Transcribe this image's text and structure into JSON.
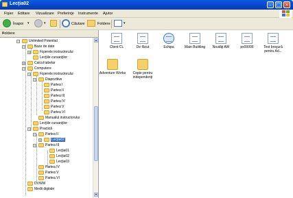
{
  "window": {
    "title": "Lecţia02"
  },
  "menu": [
    "Fişier",
    "Editare",
    "Vizualizare",
    "Preferinţe",
    "Instrumente",
    "Ajutor"
  ],
  "toolbar": {
    "back_label": "Înapoi",
    "search_label": "Căutare",
    "folders_label": "Foldere"
  },
  "panel": {
    "title": "Foldere",
    "close_glyph": "×"
  },
  "tree": [
    {
      "label": "Unlimited Potential",
      "expander": "−"
    },
    {
      "label": "Baze de date",
      "expander": "−"
    },
    {
      "label": "Fişierele instructorului",
      "expander": "+"
    },
    {
      "label": "Lecţiile cursanţilor",
      "expander": ""
    },
    {
      "label": "Calcul tabelar",
      "expander": "+"
    },
    {
      "label": "Computere",
      "expander": "−"
    },
    {
      "label": "Fişierele instructorului",
      "expander": "−"
    },
    {
      "label": "Diapozitive",
      "expander": "−"
    },
    {
      "label": "Partea I",
      "expander": ""
    },
    {
      "label": "Partea II",
      "expander": ""
    },
    {
      "label": "Partea III",
      "expander": ""
    },
    {
      "label": "Partea IV",
      "expander": ""
    },
    {
      "label": "Partea V",
      "expander": ""
    },
    {
      "label": "Partea VI",
      "expander": ""
    },
    {
      "label": "Manualul instructorului",
      "expander": ""
    },
    {
      "label": "Lecţiile cursanţilor",
      "expander": ""
    },
    {
      "label": "Practică",
      "expander": "−"
    },
    {
      "label": "Partea II",
      "expander": "−"
    },
    {
      "label": "Lecţia02",
      "expander": "+"
    },
    {
      "label": "Partea III",
      "expander": "−"
    },
    {
      "label": "Lecţia01",
      "expander": ""
    },
    {
      "label": "Lecţia02",
      "expander": ""
    },
    {
      "label": "Lecţia03",
      "expander": ""
    },
    {
      "label": "Partea IV",
      "expander": ""
    },
    {
      "label": "Partea V",
      "expander": ""
    },
    {
      "label": "Partea VI",
      "expander": ""
    },
    {
      "label": "DVWW",
      "expander": ""
    },
    {
      "label": "Medii digitale",
      "expander": ""
    }
  ],
  "selected_tree_item": "Lecţia02",
  "files": [
    {
      "name": "Client CL",
      "icon": "document-icon"
    },
    {
      "name": "De făcut",
      "icon": "document-icon"
    },
    {
      "name": "Echipa",
      "icon": "web-page-icon"
    },
    {
      "name": "Main Building",
      "icon": "document-icon"
    },
    {
      "name": "Noutăţi AW",
      "icon": "document-icon"
    },
    {
      "name": "px00005",
      "icon": "document-icon"
    },
    {
      "name": "Text broşură pentru Ad...",
      "icon": "document-icon"
    },
    {
      "name": "Adventure Works",
      "icon": "folder-icon"
    },
    {
      "name": "Copie pentru independenţi",
      "icon": "folder-icon"
    }
  ]
}
